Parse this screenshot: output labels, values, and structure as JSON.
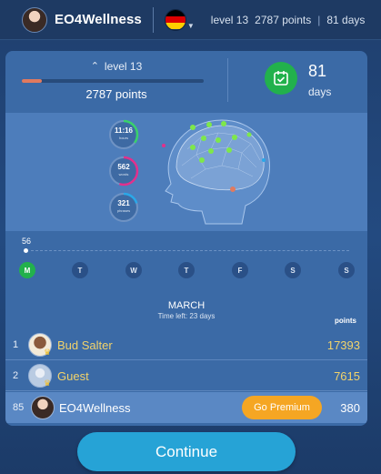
{
  "header": {
    "username": "EO4Wellness",
    "flag_icon": "germany-flag-icon",
    "flag_colors": [
      "#000000",
      "#dd0000",
      "#ffce00"
    ],
    "level": "level 13",
    "points": "2787 points",
    "separator": "|",
    "days": "81 days"
  },
  "stats": {
    "level_label": "level 13",
    "level_progress": 0.11,
    "points_label": "2787 points",
    "days_value": "81",
    "days_label": "days",
    "calendar_icon": "calendar-check-icon",
    "accent_green": "#22b14c",
    "progress_color": "#e07a5f"
  },
  "brain": {
    "rings": [
      {
        "value": "11:16",
        "unit": "hours",
        "color": "#3ad16b",
        "fraction": 0.35
      },
      {
        "value": "562",
        "unit": "words",
        "color": "#e2308c",
        "fraction": 0.55
      },
      {
        "value": "321",
        "unit": "phrases",
        "color": "#2aa8e8",
        "fraction": 0.2
      }
    ]
  },
  "week": {
    "count": "56",
    "days": [
      {
        "label": "M",
        "active": true
      },
      {
        "label": "T",
        "active": false
      },
      {
        "label": "W",
        "active": false
      },
      {
        "label": "T",
        "active": false
      },
      {
        "label": "F",
        "active": false
      },
      {
        "label": "S",
        "active": false
      },
      {
        "label": "S",
        "active": false
      }
    ]
  },
  "leaderboard": {
    "month": "MARCH",
    "time_left": "Time left: 23 days",
    "points_header": "points",
    "rows": [
      {
        "rank": "1",
        "name": "Bud Salter",
        "score": "17393"
      },
      {
        "rank": "2",
        "name": "Guest",
        "score": "7615"
      }
    ],
    "me": {
      "rank": "85",
      "name": "EO4Wellness",
      "score": "380",
      "premium_label": "Go Premium"
    }
  },
  "continue_label": "Continue"
}
